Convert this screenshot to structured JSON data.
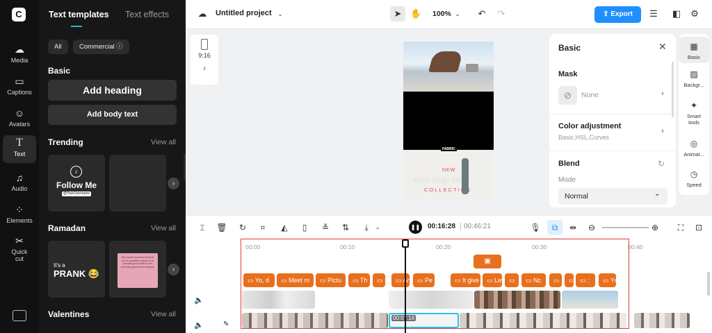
{
  "rail": {
    "items": [
      {
        "label": "Media",
        "icon": "cloud-icon"
      },
      {
        "label": "Captions",
        "icon": "captions-icon"
      },
      {
        "label": "Avatars",
        "icon": "avatar-icon"
      },
      {
        "label": "Text",
        "icon": "text-icon"
      },
      {
        "label": "Audio",
        "icon": "music-icon"
      },
      {
        "label": "Elements",
        "icon": "elements-icon"
      },
      {
        "label": "Quick cut",
        "icon": "scissors-icon"
      }
    ],
    "active": "Text"
  },
  "panel": {
    "tabs": [
      "Text templates",
      "Text effects"
    ],
    "filters": [
      "All",
      "Commercial ⓘ"
    ],
    "basic_title": "Basic",
    "add_heading": "Add heading",
    "add_body": "Add body text",
    "trending_title": "Trending",
    "ramadan_title": "Ramadan",
    "valentines_title": "Valentines",
    "view_all": "View all",
    "trending_card": {
      "title": "Follow Me",
      "handle": "@YourUsername"
    },
    "ramadan_card": {
      "line1": "It's a",
      "line2": "PRANK 😂"
    },
    "ramadan_card2": "We should remember that just as it is a positive outlook so to promote good health so are promoting good at all emotions"
  },
  "topbar": {
    "project": "Untitled project",
    "zoom": "100%",
    "export": "Export"
  },
  "canvas": {
    "ratio": "9:16",
    "video_text": {
      "brand": "FABRIC",
      "new": "NEW",
      "headline": "men's cargo shorts",
      "collection": "COLLECTION"
    }
  },
  "props": {
    "title": "Basic",
    "mask_label": "Mask",
    "mask_value": "None",
    "color_label": "Color adjustment",
    "color_sub": "Basic,HSL,Curves",
    "blend_label": "Blend",
    "mode_label": "Mode",
    "mode_value": "Normal"
  },
  "right_tools": [
    "Basic",
    "Backgr...",
    "Smart tools",
    "Animat...",
    "Speed"
  ],
  "timeline": {
    "current_time": "00:16:28",
    "total_time": "00:46:21",
    "ruler": [
      "00:00",
      "00:10",
      "00:20",
      "00:30",
      "00:40"
    ],
    "playhead_label": "00:07:16",
    "text_clips": [
      "Yo, d",
      "Meet m",
      "Pictu",
      "Th",
      "",
      "Ar",
      "Pe",
      "It give",
      "Let'",
      "",
      "Nc",
      "",
      "",
      ":",
      "Yc"
    ]
  },
  "colors": {
    "accent": "#1f8fff",
    "clip": "#e86f1e",
    "selection": "#e03c3c",
    "rail": "#111111",
    "panel": "#171717"
  }
}
